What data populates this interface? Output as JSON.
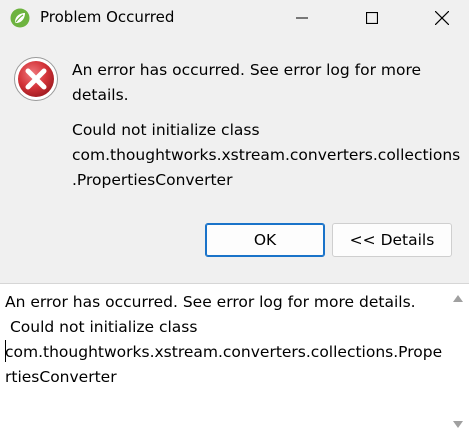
{
  "window": {
    "title": "Problem Occurred",
    "icon": "spring-leaf-icon"
  },
  "message": {
    "icon": "error-icon",
    "main": "An error has occurred. See error log for more details.",
    "detail_line1": "Could not initialize class",
    "detail_line2": "com.thoughtworks.xstream.converters.collections",
    "detail_line3": ".PropertiesConverter"
  },
  "buttons": {
    "ok_label": "OK",
    "details_label": "<< Details"
  },
  "details": {
    "text": "An error has occurred. See error log for more details.\n Could not initialize class\ncom.thoughtworks.xstream.converters.collections.PropertiesConverter"
  },
  "colors": {
    "error_red": "#d4343a",
    "focus_blue": "#1a73c9",
    "app_icon_green": "#6db33f"
  }
}
